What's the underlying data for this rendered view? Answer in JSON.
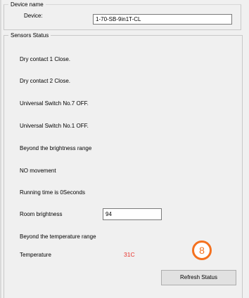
{
  "device_group": {
    "title": "Device name",
    "device_label": "Device:",
    "device_value": "1-70-SB-9in1T-CL"
  },
  "sensors_group": {
    "title": "Sensors Status",
    "items": [
      "Dry contact 1  Close.",
      "Dry contact 2  Close.",
      "Universal Switch No.7  OFF.",
      "Universal Switch No.1  OFF.",
      "Beyond the brightness range",
      "NO movement",
      "Running time is 0Seconds",
      "Room brightness",
      "Beyond the temperature range",
      "Temperature"
    ],
    "room_brightness_value": "94",
    "temperature_value": "31C",
    "refresh_button": "Refresh Status"
  },
  "annotation": {
    "badge_number": "8",
    "badge_color": "#f4711f"
  },
  "colors": {
    "background": "#f0f0f0",
    "temperature_text": "#e8312a"
  }
}
